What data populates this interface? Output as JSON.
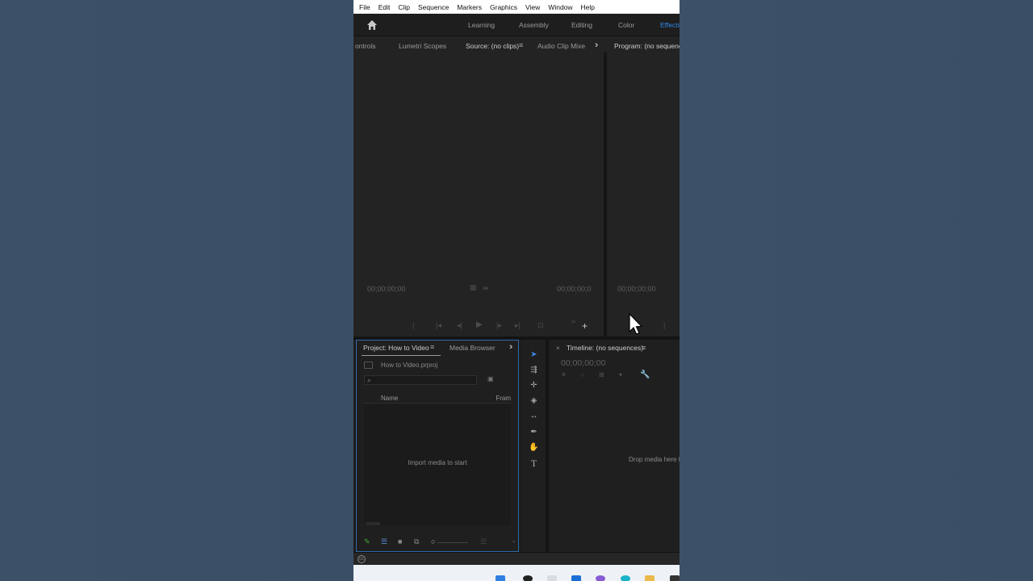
{
  "menubar": {
    "items": [
      "File",
      "Edit",
      "Clip",
      "Sequence",
      "Markers",
      "Graphics",
      "View",
      "Window",
      "Help"
    ]
  },
  "workspaces": {
    "tabs": [
      "Learning",
      "Assembly",
      "Editing",
      "Color",
      "Effects"
    ],
    "active": "Effects",
    "home_icon": "home-icon"
  },
  "panels_upper": {
    "tabs": {
      "controls": "ontrols",
      "lumetri": "Lumetri Scopes",
      "source": "Source: (no clips)",
      "audio_mixer": "Audio Clip Mixe",
      "program": "Program: (no sequence"
    },
    "source_monitor": {
      "timecode_left": "00;00;00;00",
      "timecode_right": "00;00;00;0"
    },
    "program_monitor": {
      "timecode_left": "00;00;00;00"
    }
  },
  "project_panel": {
    "tabs": [
      "Project: How to Video",
      "Media Browser"
    ],
    "file_name": "How to Video.prproj",
    "search_placeholder": "",
    "columns": [
      "Name",
      "Fram"
    ],
    "empty_message": "Import media to start"
  },
  "tools": [
    "selection-tool",
    "track-select-tool",
    "ripple-edit-tool",
    "razor-tool",
    "slip-tool",
    "pen-tool",
    "hand-tool",
    "type-tool"
  ],
  "timeline_panel": {
    "title": "Timeline: (no sequences)",
    "timecode": "00;00;00;00",
    "drop_message": "Drop media here t"
  },
  "colors": {
    "accent": "#2d8ceb",
    "panel_bg": "#232323",
    "desktop_bg": "#3b5066",
    "active_border": "#2e6aa9"
  }
}
